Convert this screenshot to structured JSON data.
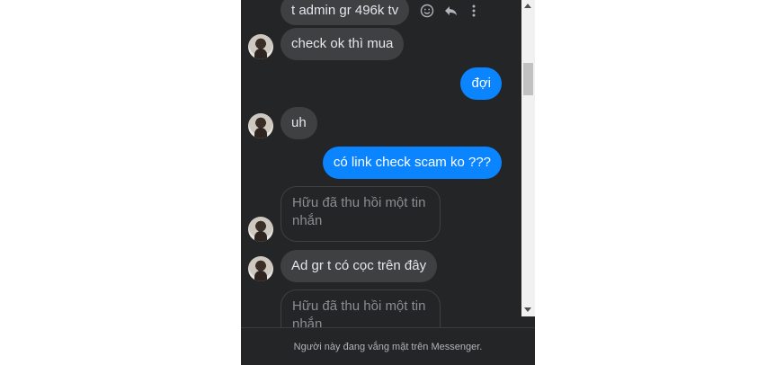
{
  "messages": [
    {
      "text": "t admin gr 496k tv"
    },
    {
      "text": "check ok thì mua"
    },
    {
      "text": "đợi"
    },
    {
      "text": "uh"
    },
    {
      "text": "có link check scam ko ???"
    },
    {
      "text": "Hữu đã thu hồi một tin nhắn"
    },
    {
      "text": "Ad gr t có cọc trên đây"
    },
    {
      "text": "Hữu đã thu hồi một tin nhắn"
    }
  ],
  "footer": {
    "text": "Người này đang vắng mặt trên Messenger."
  },
  "icons": {
    "react": "smiley-icon",
    "reply": "reply-icon",
    "more": "more-icon"
  },
  "colors": {
    "background": "#242526",
    "incoming_bubble": "#3e4042",
    "outgoing_bubble": "#0a84ff"
  }
}
